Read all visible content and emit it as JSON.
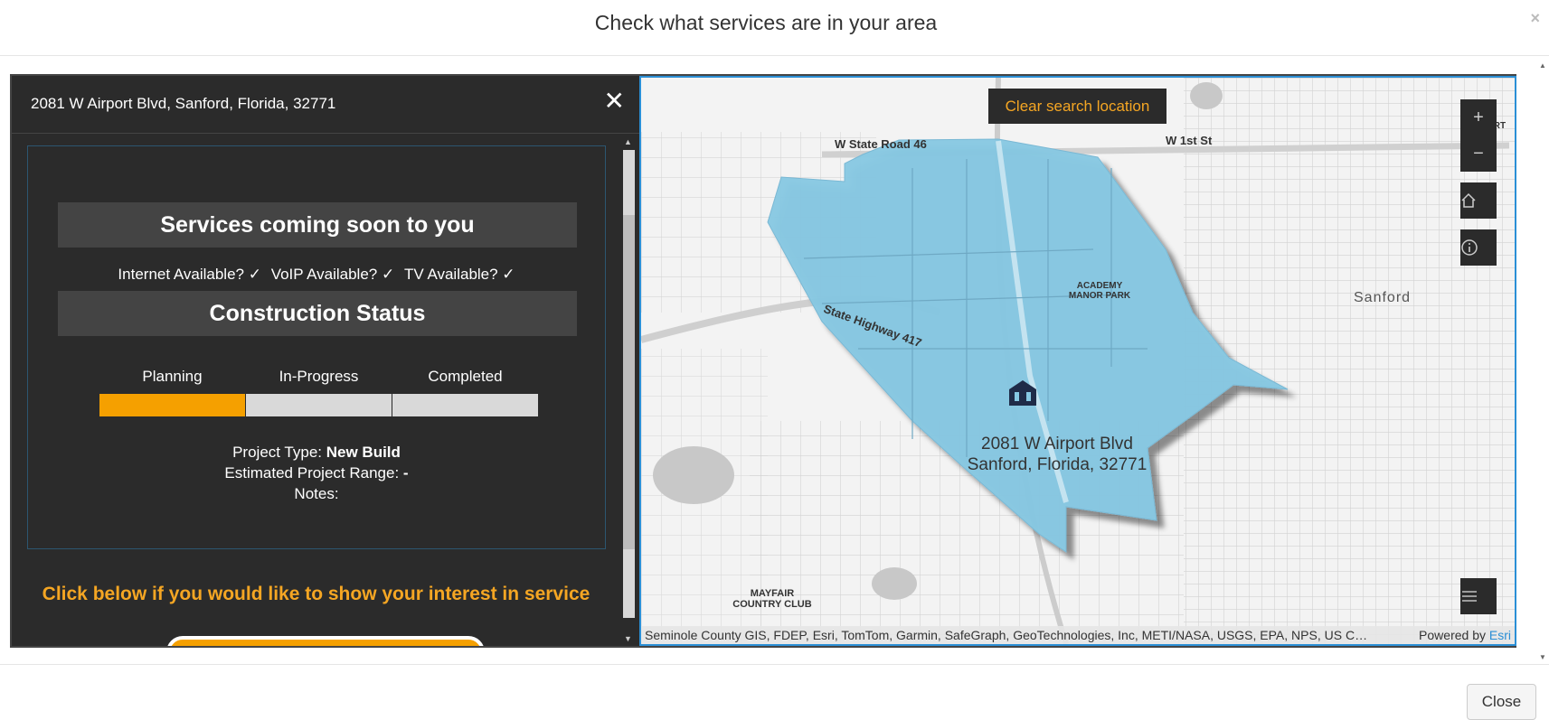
{
  "modal": {
    "title": "Check what services are in your area",
    "close_x": "×",
    "footer_close_label": "Close"
  },
  "panel": {
    "address": "2081 W Airport Blvd, Sanford, Florida, 32771",
    "close_glyph": "✕",
    "services_heading": "Services coming soon to you",
    "availability": [
      {
        "label": "Internet Available? ✓"
      },
      {
        "label": "VoIP Available? ✓"
      },
      {
        "label": "TV Available?  ✓"
      }
    ],
    "construction_heading": "Construction Status",
    "steps": [
      {
        "label": "Planning",
        "active": true
      },
      {
        "label": "In-Progress",
        "active": false
      },
      {
        "label": "Completed",
        "active": false
      }
    ],
    "project_type_label": "Project Type: ",
    "project_type_value": "New Build",
    "estimated_range_label": "Estimated Project Range: ",
    "estimated_range_value": "-",
    "notes_label": "Notes:",
    "cta_text": "Click below if you would like to show your interest in service"
  },
  "map": {
    "clear_search_label": "Clear search location",
    "zoom_in": "+",
    "zoom_out": "−",
    "home_icon": "home-icon",
    "info_icon": "info-icon",
    "layers_icon": "list-icon",
    "labels": {
      "w_state_road": "W State Road 46",
      "w_1st": "W 1st St",
      "state_highway": "State Highway 417",
      "academy_line1": "ACADEMY",
      "academy_line2": "MANOR PARK",
      "sanford": "Sanford",
      "mayfair_line1": "MAYFAIR",
      "mayfair_line2": "COUNTRY CLUB",
      "edge_ort": "ORT"
    },
    "pin_address_line1": "2081 W Airport Blvd",
    "pin_address_line2": "Sanford, Florida, 32771",
    "attribution": "Seminole County GIS, FDEP, Esri, TomTom, Garmin, SafeGraph, GeoTechnologies, Inc, METI/NASA, USGS, EPA, NPS, US C…",
    "powered_by": "Powered by ",
    "esri": "Esri"
  },
  "colors": {
    "accent": "#f5a000",
    "panel_bg": "#2b2b2b",
    "service_area": "#86c8e3",
    "map_border": "#2a8fd6"
  }
}
